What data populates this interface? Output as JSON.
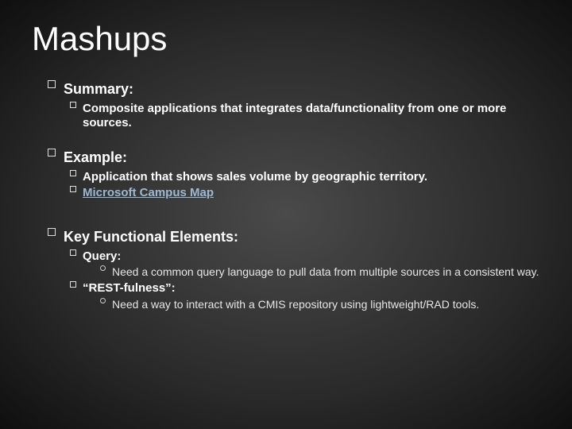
{
  "title": "Mashups",
  "sections": [
    {
      "heading": "Summary:",
      "items": [
        {
          "text": "Composite applications that integrates data/functionality from one or more sources."
        }
      ]
    },
    {
      "heading": "Example:",
      "items": [
        {
          "text": "Application that shows sales volume by geographic territory."
        },
        {
          "text": "Microsoft Campus Map",
          "link": true
        }
      ]
    },
    {
      "heading": "Key Functional Elements:",
      "items": [
        {
          "text": "Query:",
          "sub": [
            "Need a common query language to pull data from multiple sources in a consistent way."
          ]
        },
        {
          "text": "“REST-fulness”:",
          "sub": [
            "Need a way to interact with a CMIS repository using lightweight/RAD tools."
          ]
        }
      ]
    }
  ]
}
